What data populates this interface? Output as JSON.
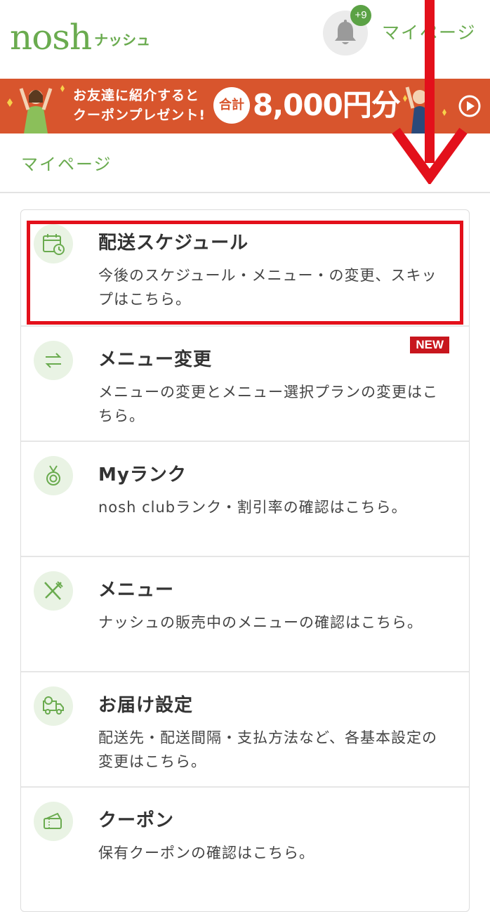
{
  "header": {
    "logo_main": "nosh",
    "logo_sub": "ナッシュ",
    "notification_count": "+9",
    "mypage_link": "マイページ"
  },
  "banner": {
    "line1": "お友達に紹介すると",
    "line2": "クーポンプレゼント!",
    "circle_label": "合計",
    "amount": "8,000円分"
  },
  "breadcrumb": "マイページ",
  "menu": {
    "items": [
      {
        "title": "配送スケジュール",
        "desc": "今後のスケジュール・メニュー・の変更、スキップはこちら。",
        "icon": "calendar-clock-icon"
      },
      {
        "title": "メニュー変更",
        "desc": "メニューの変更とメニュー選択プランの変更はこちら。",
        "icon": "swap-arrows-icon",
        "badge": "NEW"
      },
      {
        "title": "Myランク",
        "desc": "nosh clubランク・割引率の確認はこちら。",
        "icon": "medal-icon"
      },
      {
        "title": "メニュー",
        "desc": "ナッシュの販売中のメニューの確認はこちら。",
        "icon": "fork-knife-icon"
      },
      {
        "title": "お届け設定",
        "desc": "配送先・配送間隔・支払方法など、各基本設定の変更はこちら。",
        "icon": "delivery-truck-icon"
      },
      {
        "title": "クーポン",
        "desc": "保有クーポンの確認はこちら。",
        "icon": "coupon-ticket-icon"
      }
    ]
  },
  "colors": {
    "brand_green": "#6aab4f",
    "banner_orange": "#d8552d",
    "annotation_red": "#e3101b",
    "new_badge_red": "#c8161d"
  }
}
